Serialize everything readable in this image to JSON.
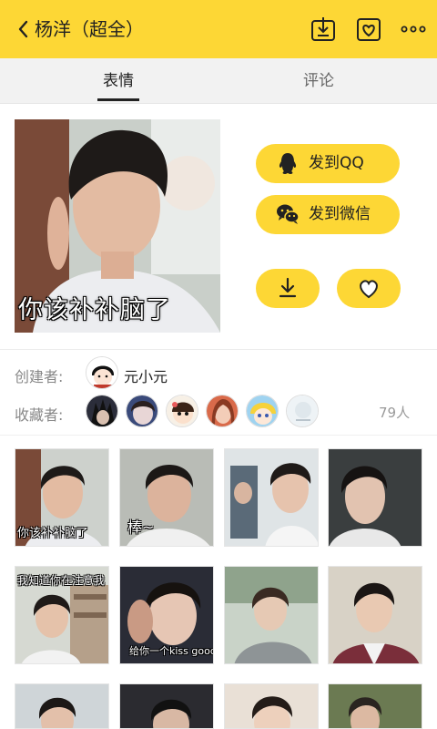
{
  "header": {
    "title": "杨洋（超全）",
    "back_icon": "chevron-left-icon",
    "download_icon": "download-box-icon",
    "favorite_icon": "heart-box-icon",
    "more_icon": "more-dots-icon",
    "bg_color": "#fdd735"
  },
  "tabs": [
    {
      "label": "表情",
      "active": true
    },
    {
      "label": "评论",
      "active": false
    }
  ],
  "main": {
    "image_caption": "你该补补脑了",
    "send_qq_label": "发到QQ",
    "send_wechat_label": "发到微信",
    "qq_icon": "qq-penguin-icon",
    "wechat_icon": "wechat-icon",
    "download_icon": "download-icon",
    "favorite_icon": "heart-icon"
  },
  "info": {
    "creator_label": "创建者:",
    "creator_name": "元小元",
    "collector_label": "收藏者:",
    "collector_count": "79人"
  },
  "grid": [
    {
      "caption": "你该补补脑了"
    },
    {
      "caption": "棒~"
    },
    {
      "caption": ""
    },
    {
      "caption": ""
    },
    {
      "caption_top": "我知道你在注意我"
    },
    {
      "caption": "给你一个kiss goodbye"
    },
    {
      "caption": ""
    },
    {
      "caption": ""
    },
    {
      "caption": ""
    },
    {
      "caption": ""
    },
    {
      "caption": ""
    },
    {
      "caption": ""
    }
  ]
}
